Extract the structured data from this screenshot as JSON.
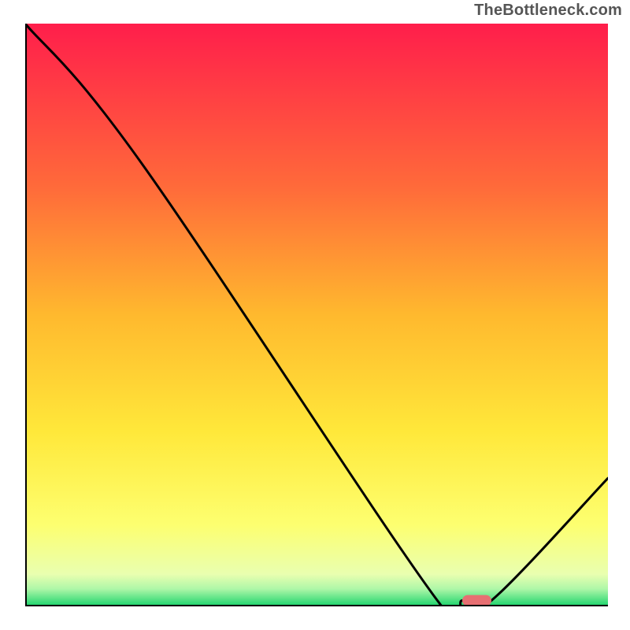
{
  "watermark": "TheBottleneck.com",
  "chart_data": {
    "type": "line",
    "title": "",
    "xlabel": "",
    "ylabel": "",
    "xlim": [
      0,
      100
    ],
    "ylim": [
      0,
      100
    ],
    "series": [
      {
        "name": "curve",
        "x": [
          0,
          20,
          70,
          75,
          80,
          100
        ],
        "values": [
          100,
          76,
          2,
          1,
          1,
          22
        ]
      }
    ],
    "marker": {
      "x_start": 75,
      "x_end": 80,
      "y": 1,
      "color": "#e76f72"
    },
    "gradient_stops": [
      {
        "offset": 0,
        "color": "#ff1e4b"
      },
      {
        "offset": 0.28,
        "color": "#ff6a3a"
      },
      {
        "offset": 0.5,
        "color": "#ffb92e"
      },
      {
        "offset": 0.7,
        "color": "#ffe83a"
      },
      {
        "offset": 0.86,
        "color": "#fdff70"
      },
      {
        "offset": 0.945,
        "color": "#e9ffb0"
      },
      {
        "offset": 0.97,
        "color": "#aef7a8"
      },
      {
        "offset": 1.0,
        "color": "#19d36b"
      }
    ],
    "axis_color": "#000000",
    "line_color": "#000000"
  }
}
